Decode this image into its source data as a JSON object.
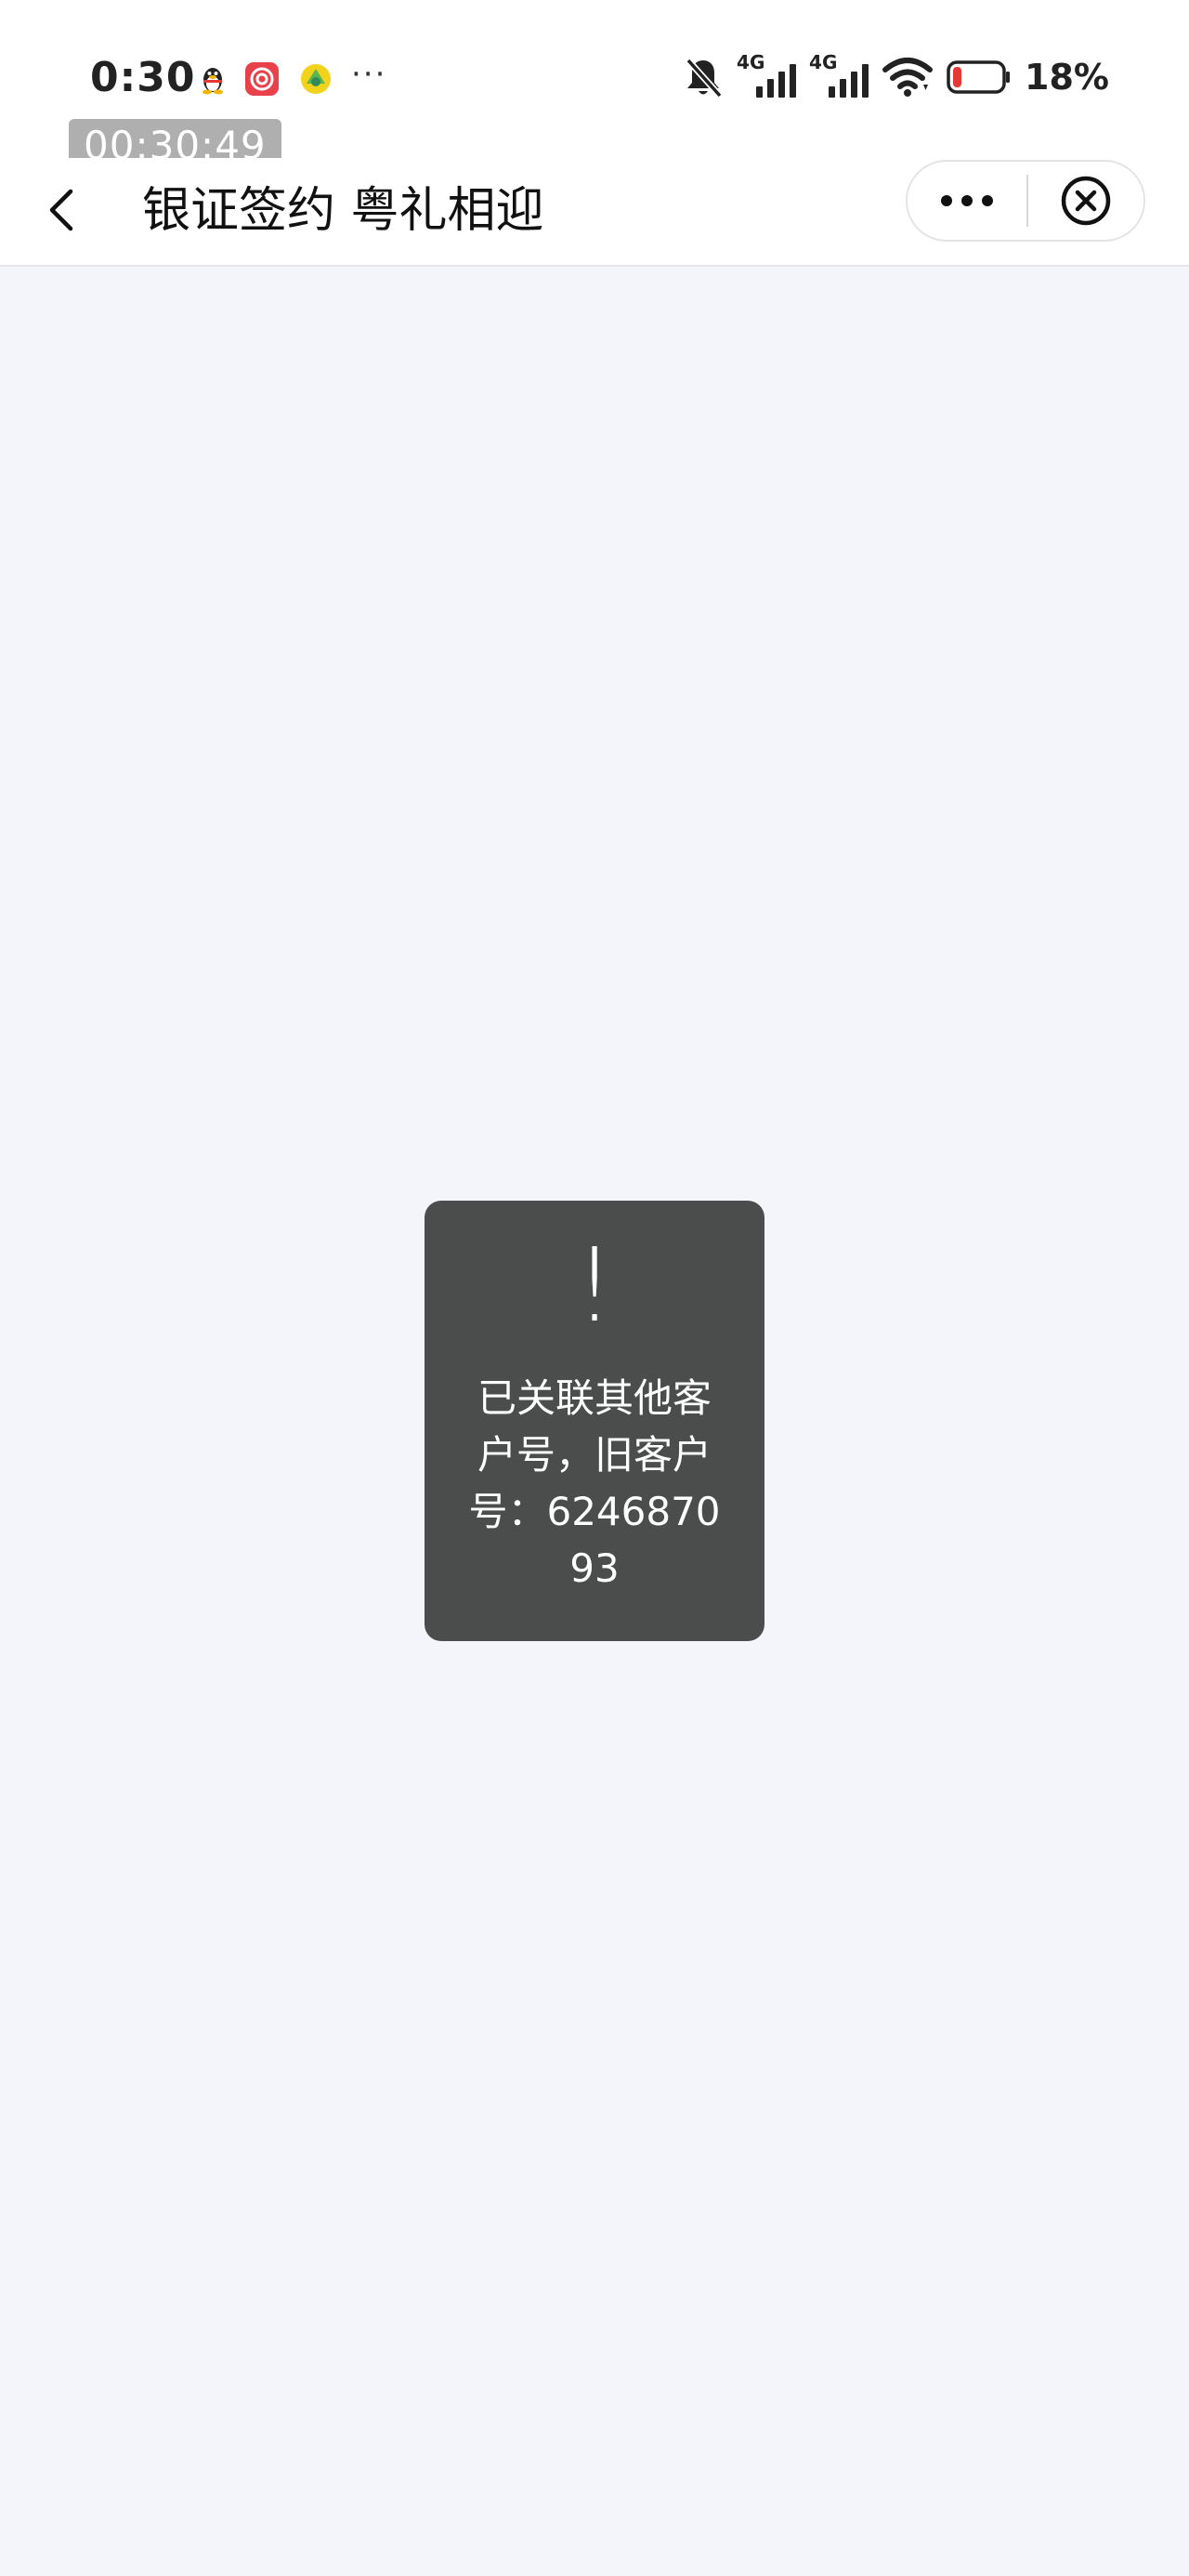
{
  "status_bar": {
    "time": "0:30",
    "notification_icons": [
      "qq-icon",
      "unionpay-icon",
      "app-icon"
    ],
    "more_notifications": "···",
    "network_1": "4G",
    "network_2": "4G",
    "battery_percent": "18%",
    "battery_level": 0.18,
    "battery_color": "#e53935"
  },
  "timer": "00:30:49",
  "nav": {
    "title": "银证签约 粤礼相迎"
  },
  "toast": {
    "icon": "!",
    "message": "已关联其他客户号，旧客户号：624687093"
  }
}
